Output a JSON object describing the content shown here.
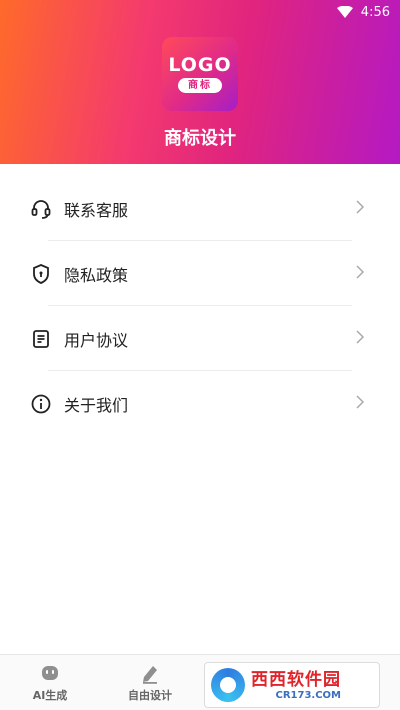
{
  "status": {
    "time": "4:56"
  },
  "header": {
    "logo_text": "LOGO",
    "logo_sub": "商标",
    "title": "商标设计"
  },
  "menu": {
    "items": [
      {
        "label": "联系客服",
        "icon": "headset-icon"
      },
      {
        "label": "隐私政策",
        "icon": "shield-icon"
      },
      {
        "label": "用户协议",
        "icon": "document-icon"
      },
      {
        "label": "关于我们",
        "icon": "info-icon"
      }
    ]
  },
  "tabbar": {
    "tabs": [
      {
        "label": "AI生成",
        "icon": "robot-icon"
      },
      {
        "label": "自由设计",
        "icon": "pen-icon"
      }
    ]
  },
  "watermark": {
    "brand": "西西软件园",
    "url": "CR173.COM"
  }
}
